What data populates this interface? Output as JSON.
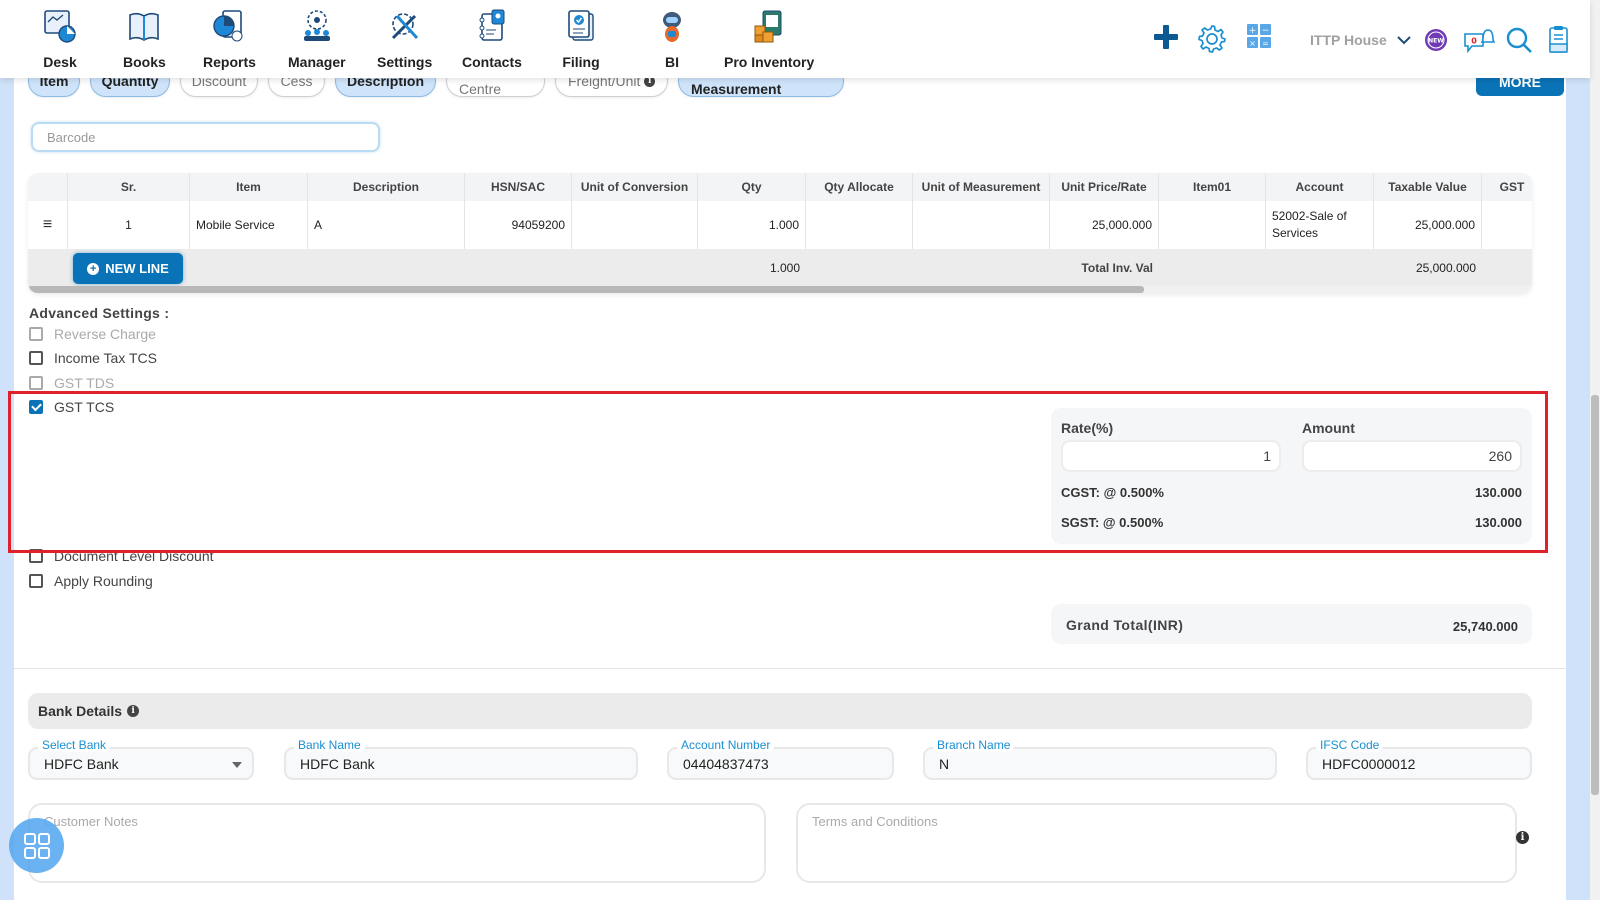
{
  "nav": {
    "items": [
      {
        "label": "Desk",
        "icon": "desk-icon"
      },
      {
        "label": "Books",
        "icon": "books-icon"
      },
      {
        "label": "Reports",
        "icon": "reports-icon"
      },
      {
        "label": "Manager",
        "icon": "manager-icon"
      },
      {
        "label": "Settings",
        "icon": "settings-icon"
      },
      {
        "label": "Contacts",
        "icon": "contacts-icon"
      },
      {
        "label": "Filing",
        "icon": "filing-icon"
      },
      {
        "label": "BI",
        "icon": "bi-robot-icon"
      },
      {
        "label": "Pro Inventory",
        "icon": "pro-inventory-icon"
      }
    ],
    "company": "ITTP House",
    "new_badge": "NEW",
    "notification_count": "0"
  },
  "chips": [
    {
      "label": "Item",
      "active": true
    },
    {
      "label": "Quantity",
      "active": true
    },
    {
      "label": "Discount",
      "active": false
    },
    {
      "label": "Cess",
      "active": false
    },
    {
      "label": "Description",
      "active": true
    },
    {
      "label": "Cost Centre",
      "active": false
    },
    {
      "label": "Freight/Unit",
      "active": false,
      "info": true
    },
    {
      "label": "Unit Of Measurement",
      "active": true
    }
  ],
  "more_label": "MORE",
  "barcode_placeholder": "Barcode",
  "table": {
    "headers": [
      "",
      "Sr.",
      "Item",
      "Description",
      "HSN/SAC",
      "Unit of Conversion",
      "Qty",
      "Qty Allocate",
      "Unit of Measurement",
      "Unit Price/Rate",
      "Item01",
      "Account",
      "Taxable Value",
      "GST"
    ],
    "rows": [
      {
        "sr": "1",
        "item": "Mobile Service",
        "description": "A",
        "hsn": "94059200",
        "unit_conversion": "",
        "qty": "1.000",
        "qty_allocate": "",
        "uom": "",
        "rate": "25,000.000",
        "item01": "",
        "account": "52002-Sale of Services",
        "taxable_value": "25,000.000",
        "gst": ""
      }
    ],
    "footer": {
      "new_line_label": "NEW LINE",
      "qty_total": "1.000",
      "total_label": "Total Inv. Val",
      "taxable_total": "25,000.000"
    }
  },
  "advanced": {
    "title": "Advanced Settings :",
    "options": [
      {
        "label": "Reverse Charge",
        "checked": false,
        "disabled": true
      },
      {
        "label": "Income Tax TCS",
        "checked": false,
        "disabled": false
      },
      {
        "label": "GST TDS",
        "checked": false,
        "disabled": true
      },
      {
        "label": "GST TCS",
        "checked": true,
        "disabled": false
      },
      {
        "label": "Document Level Discount",
        "checked": false,
        "disabled": false
      },
      {
        "label": "Apply Rounding",
        "checked": false,
        "disabled": false
      }
    ]
  },
  "tcs": {
    "rate_label": "Rate(%)",
    "rate_value": "1",
    "amount_label": "Amount",
    "amount_value": "260",
    "cgst_label": "CGST: @ 0.500%",
    "cgst_value": "130.000",
    "sgst_label": "SGST: @ 0.500%",
    "sgst_value": "130.000"
  },
  "grand_total": {
    "label": "Grand Total(INR)",
    "value": "25,740.000"
  },
  "bank": {
    "title": "Bank Details",
    "fields": [
      {
        "label": "Select Bank",
        "value": "HDFC Bank"
      },
      {
        "label": "Bank Name",
        "value": "HDFC Bank"
      },
      {
        "label": "Account Number",
        "value": "04404837473"
      },
      {
        "label": "Branch Name",
        "value": "N"
      },
      {
        "label": "IFSC Code",
        "value": "HDFC0000012"
      }
    ]
  },
  "notes_placeholder": "Customer Notes",
  "terms_placeholder": "Terms and Conditions",
  "colors": {
    "primary": "#0a73b7",
    "highlight": "#e0202a",
    "chip_active": "#cfe4fb",
    "label_blue": "#1a8fd0"
  }
}
